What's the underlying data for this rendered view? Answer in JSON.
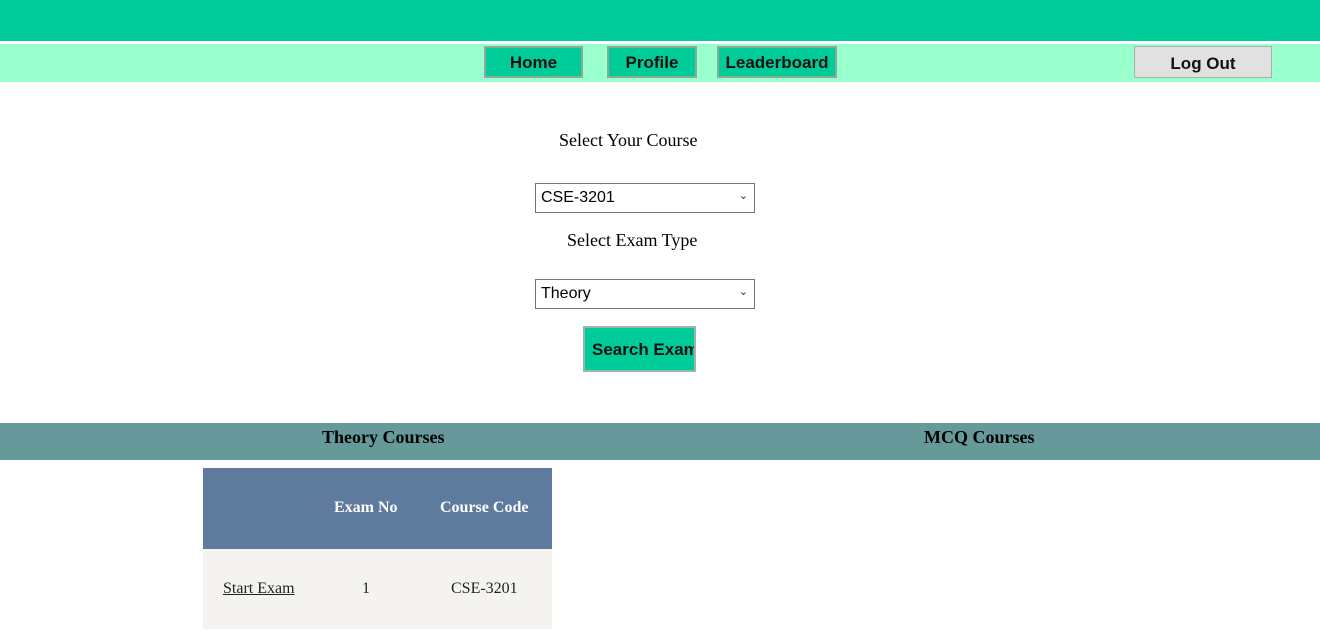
{
  "nav": {
    "home": "Home",
    "profile": "Profile",
    "leaderboard": "Leaderboard",
    "logout": "Log Out"
  },
  "form": {
    "course_label": "Select Your Course",
    "course_value": "CSE-3201",
    "type_label": "Select Exam Type",
    "type_value": "Theory",
    "search_button": "Search Exam"
  },
  "sections": {
    "theory_title": "Theory Courses",
    "mcq_title": "MCQ Courses"
  },
  "theory_table": {
    "headers": [
      "",
      "Exam No",
      "Course Code"
    ],
    "rows": [
      {
        "action": "Start Exam",
        "exam_no": "1",
        "course_code": "CSE-3201"
      }
    ]
  },
  "colors": {
    "accent": "#00cc99",
    "nav_bg": "#99ffcc",
    "section_bg": "#669999",
    "table_header": "#5e7a9c"
  }
}
